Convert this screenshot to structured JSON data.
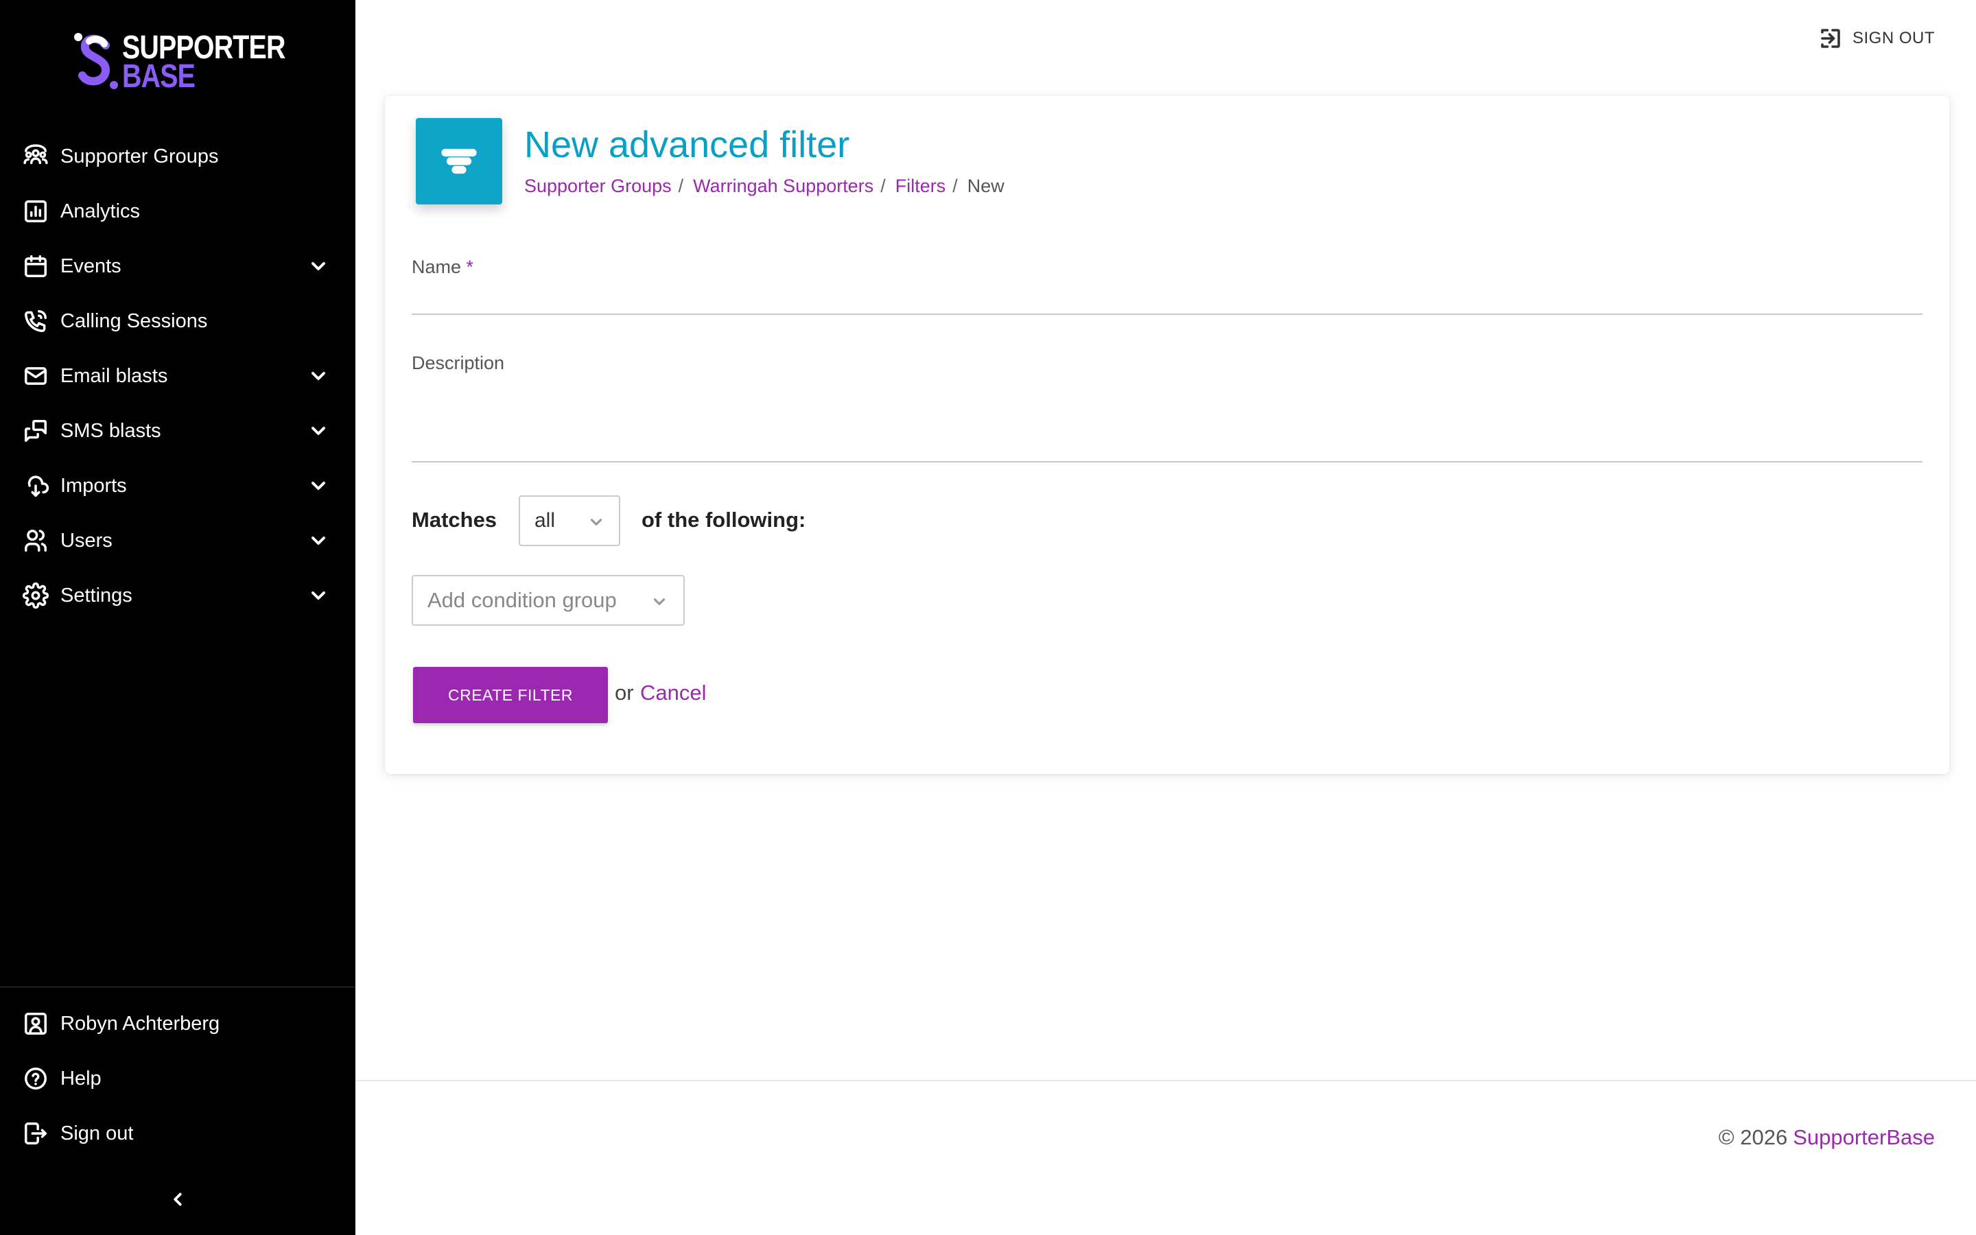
{
  "brand": {
    "line1": "SUPPORTER",
    "line2": "BASE",
    "accent_color": "#8b5cf6"
  },
  "sidebar": {
    "items": [
      {
        "label": "Supporter Groups",
        "icon": "supporter-groups-icon",
        "has_submenu": false
      },
      {
        "label": "Analytics",
        "icon": "analytics-icon",
        "has_submenu": false
      },
      {
        "label": "Events",
        "icon": "calendar-icon",
        "has_submenu": true
      },
      {
        "label": "Calling Sessions",
        "icon": "phone-icon",
        "has_submenu": false
      },
      {
        "label": "Email blasts",
        "icon": "mail-icon",
        "has_submenu": true
      },
      {
        "label": "SMS blasts",
        "icon": "chat-icon",
        "has_submenu": true
      },
      {
        "label": "Imports",
        "icon": "import-icon",
        "has_submenu": true
      },
      {
        "label": "Users",
        "icon": "users-icon",
        "has_submenu": true
      },
      {
        "label": "Settings",
        "icon": "gear-icon",
        "has_submenu": true
      }
    ],
    "bottom": [
      {
        "label": "Robyn Achterberg",
        "icon": "user-portrait-icon"
      },
      {
        "label": "Help",
        "icon": "help-icon"
      },
      {
        "label": "Sign out",
        "icon": "sign-out-icon"
      }
    ],
    "collapse_icon": "chevron-left-icon"
  },
  "topbar": {
    "sign_out_label": "SIGN OUT",
    "sign_out_icon": "sign-out-box-icon"
  },
  "page": {
    "title": "New advanced filter",
    "header_icon": "filter-icon",
    "header_icon_color": "#0ea5c9",
    "breadcrumb": [
      {
        "label": "Supporter Groups",
        "link": true
      },
      {
        "label": "Warringah Supporters",
        "link": true
      },
      {
        "label": "Filters",
        "link": true
      },
      {
        "label": "New",
        "link": false
      }
    ],
    "separator": "/"
  },
  "form": {
    "name_label": "Name",
    "name_required_mark": "*",
    "name_value": "",
    "description_label": "Description",
    "description_value": "",
    "matches_label": "Matches",
    "matches_value": "all",
    "following_label": "of the following:",
    "condition_group_placeholder": "Add condition group",
    "create_button": "CREATE FILTER",
    "or_text": "or",
    "cancel_label": "Cancel",
    "accent_color": "#9c27b0"
  },
  "footer": {
    "copyright": "© 2026",
    "brand_link": "SupporterBase"
  }
}
